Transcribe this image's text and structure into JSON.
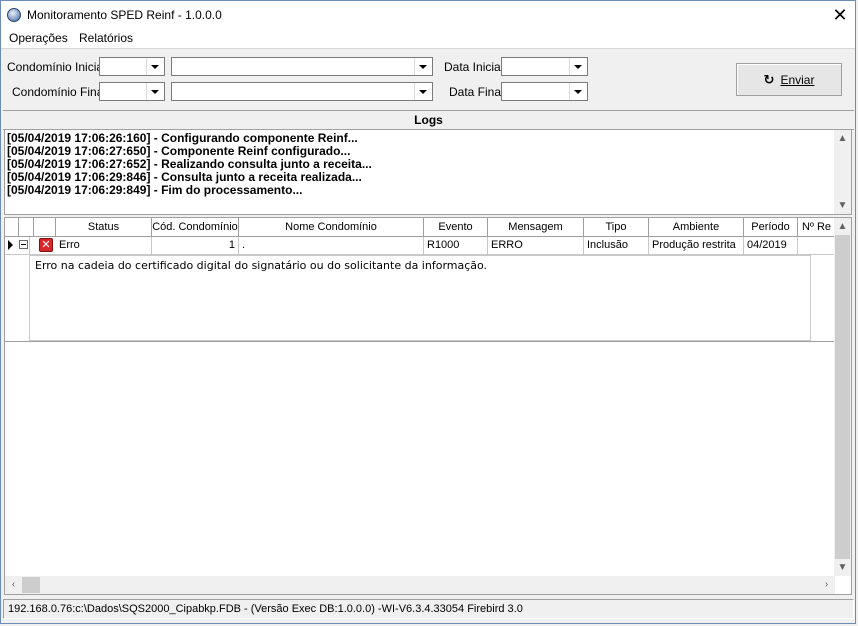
{
  "window": {
    "title": "Monitoramento SPED Reinf - 1.0.0.0",
    "close_glyph": "✕"
  },
  "menu": {
    "items": [
      "Operações",
      "Relatórios"
    ]
  },
  "filters": {
    "condominio_inicial_label": "Condomínio Inicial",
    "condominio_final_label": "Condomínio Final",
    "data_inicial_label": "Data Inicial",
    "data_final_label": "Data Final",
    "enviar_label": "Enviar"
  },
  "logs": {
    "header": "Logs",
    "lines": [
      "[05/04/2019 17:06:26:160] - Configurando componente Reinf...",
      "[05/04/2019 17:06:27:650] - Componente Reinf configurado...",
      "[05/04/2019 17:06:27:652] - Realizando consulta junto a receita...",
      "[05/04/2019 17:06:29:846] - Consulta junto a receita realizada...",
      "[05/04/2019 17:06:29:849] - Fim do processamento..."
    ]
  },
  "grid": {
    "columns": [
      "Status",
      "Cód. Condomínio",
      "Nome Condomínio",
      "Evento",
      "Mensagem",
      "Tipo",
      "Ambiente",
      "Período",
      "Nº Re"
    ],
    "rows": [
      {
        "status": "Erro",
        "cod_condominio": "1",
        "nome_condominio": ".",
        "evento": "R1000",
        "mensagem": "ERRO",
        "tipo": "Inclusão",
        "ambiente": "Produção restrita",
        "periodo": "04/2019",
        "detail": "Erro na cadeia do certificado digital do signatário ou do solicitante da informação."
      }
    ]
  },
  "status_bar": {
    "text": "192.168.0.76:c:\\Dados\\SQS2000_Cipabkp.FDB - (Versão Exec DB:1.0.0.0) -WI-V6.3.4.33054 Firebird 3.0"
  },
  "colors": {
    "error_icon": "#d8262b",
    "window_border": "#6b8bb8"
  }
}
